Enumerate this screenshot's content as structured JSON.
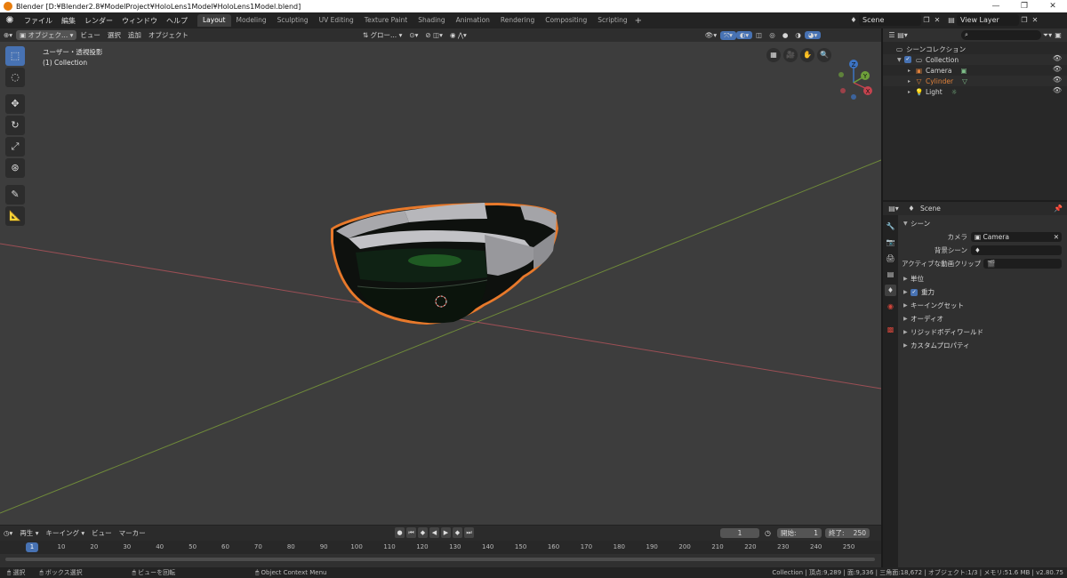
{
  "window": {
    "title": "Blender [D:¥Blender2.8¥ModelProject¥HoloLens1Model¥HoloLens1Model.blend]",
    "controls": [
      "—",
      "❐",
      "✕"
    ]
  },
  "menu": [
    "ファイル",
    "編集",
    "レンダー",
    "ウィンドウ",
    "ヘルプ"
  ],
  "workspaces": [
    "Layout",
    "Modeling",
    "Sculpting",
    "UV Editing",
    "Texture Paint",
    "Shading",
    "Animation",
    "Rendering",
    "Compositing",
    "Scripting"
  ],
  "scene_name": "Scene",
  "view_layer": "View Layer",
  "viewport": {
    "mode": "オブジェク...",
    "menus": [
      "ビュー",
      "選択",
      "追加",
      "オブジェクト"
    ],
    "transform_orientation": "グロー...",
    "view_label": "ユーザー・透視投影",
    "collection_label": "(1) Collection",
    "gizmo": {
      "x": "X",
      "y": "Y",
      "z": "Z"
    }
  },
  "outliner": {
    "scene_collection": "シーンコレクション",
    "collection": "Collection",
    "objects": [
      {
        "name": "Camera",
        "color": "#d3d3d3",
        "icon_color": "#e0813a"
      },
      {
        "name": "Cylinder",
        "color": "#e0813a",
        "icon_color": "#e0813a"
      },
      {
        "name": "Light",
        "color": "#d3d3d3",
        "icon_color": "#e0813a"
      }
    ]
  },
  "properties": {
    "header": "Scene",
    "panel": "シーン",
    "camera_label": "カメラ",
    "camera_value": "Camera",
    "bg_scene_label": "背景シーン",
    "clip_label": "アクティブな動画クリップ",
    "sections": [
      "単位",
      "重力",
      "キーイングセット",
      "オーディオ",
      "リジッドボディワールド",
      "カスタムプロパティ"
    ]
  },
  "timeline": {
    "menus": [
      "再生",
      "キーイング",
      "ビュー",
      "マーカー"
    ],
    "current_frame": "1",
    "start_label": "開始:",
    "start": "1",
    "end_label": "終了:",
    "end": "250",
    "ruler": [
      "1",
      "10",
      "20",
      "30",
      "40",
      "50",
      "60",
      "70",
      "80",
      "90",
      "100",
      "110",
      "120",
      "130",
      "140",
      "150",
      "160",
      "170",
      "180",
      "190",
      "200",
      "210",
      "220",
      "230",
      "240",
      "250"
    ]
  },
  "status": {
    "select": "選択",
    "box_select": "ボックス選択",
    "rotate_view": "ビューを回転",
    "context_menu": "Object Context Menu",
    "stats": "Collection | 頂点:9,289 | 面:9,336 | 三角面:18,672 | オブジェクト:1/3 | メモリ:51.6 MB | v2.80.75"
  },
  "colors": {
    "accent": "#4772b3",
    "selection_outline": "#e8792b",
    "x_axis": "#d05a5a",
    "y_axis": "#8ab540"
  }
}
